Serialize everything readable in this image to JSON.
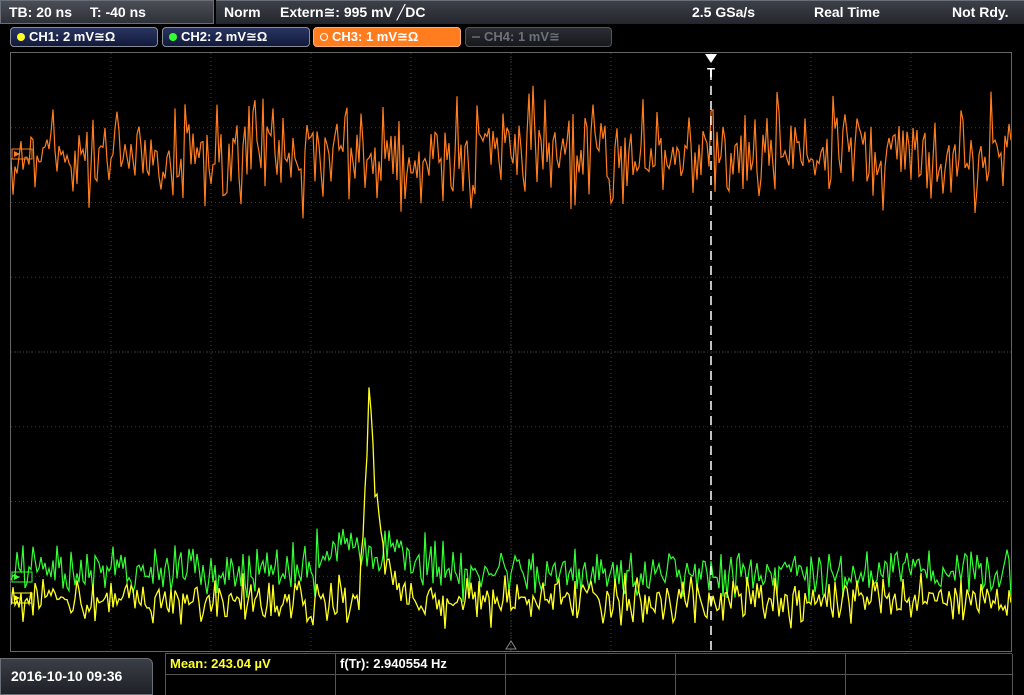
{
  "topbar": {
    "timebase": "TB: 20 ns",
    "trigger_time": "T: -40 ns",
    "trigger_mode": "Norm",
    "trigger_source": "Extern≅: 995 mV ╱DC",
    "sample_rate": "2.5 GSa/s",
    "acq_mode": "Real Time",
    "status": "Not Rdy."
  },
  "channels": [
    {
      "label": "CH1: 2 mV≅Ω",
      "color": "#ffff20",
      "state": "on"
    },
    {
      "label": "CH2: 2 mV≅Ω",
      "color": "#33ff33",
      "state": "on"
    },
    {
      "label": "CH3: 1 mV≅Ω",
      "color": "#ff7d1f",
      "state": "active"
    },
    {
      "label": "CH4: 1 mV≅",
      "color": "#555a60",
      "state": "off"
    }
  ],
  "measurements": {
    "mean": "Mean: 243.04 µV",
    "freq": "f(Tr): 2.940554 Hz"
  },
  "datetime": "2016-10-10 09:36",
  "trigger_marker": "T",
  "colors": {
    "ch1": "#ffff20",
    "ch2": "#33ff33",
    "ch3": "#ff7d1f",
    "grid": "#3a3a3a"
  }
}
